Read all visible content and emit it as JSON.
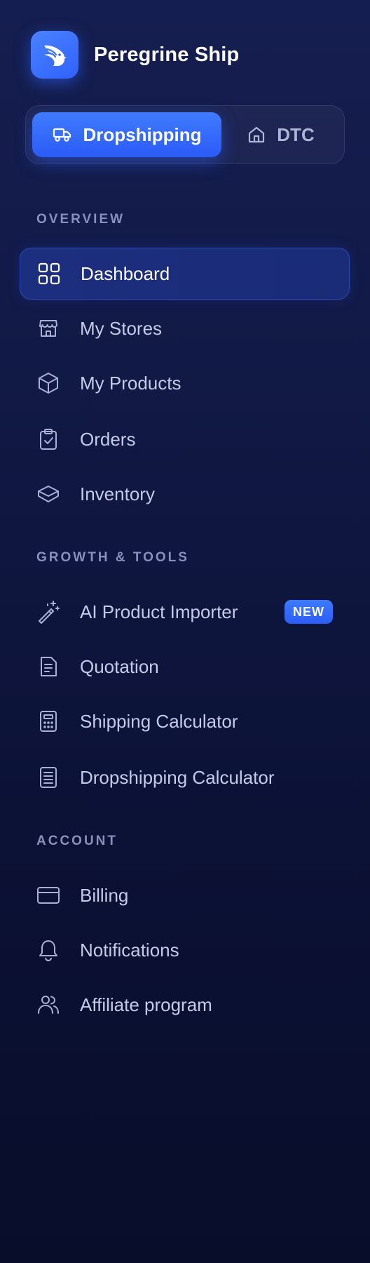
{
  "brand": {
    "name": "Peregrine Ship",
    "logo_icon": "falcon-logo-icon",
    "accent": "#2f62ff"
  },
  "mode_switch": {
    "options": [
      {
        "label": "Dropshipping",
        "icon": "truck-icon",
        "active": true
      },
      {
        "label": "DTC",
        "icon": "home-icon",
        "active": false
      }
    ]
  },
  "sections": {
    "overview": {
      "title": "OVERVIEW",
      "items": [
        {
          "label": "Dashboard",
          "icon": "grid-icon",
          "active": true
        },
        {
          "label": "My Stores",
          "icon": "store-icon"
        },
        {
          "label": "My Products",
          "icon": "box-icon"
        },
        {
          "label": "Orders",
          "icon": "clipboard-check-icon"
        },
        {
          "label": "Inventory",
          "icon": "package-open-icon"
        }
      ]
    },
    "growth": {
      "title": "GROWTH & TOOLS",
      "items": [
        {
          "label": "AI Product Importer",
          "icon": "magic-wand-icon",
          "badge": "NEW"
        },
        {
          "label": "Quotation",
          "icon": "document-icon"
        },
        {
          "label": "Shipping Calculator",
          "icon": "calculator-icon"
        },
        {
          "label": "Dropshipping Calculator",
          "icon": "list-document-icon"
        }
      ]
    },
    "account": {
      "title": "ACCOUNT",
      "items": [
        {
          "label": "Billing",
          "icon": "credit-card-icon"
        },
        {
          "label": "Notifications",
          "icon": "bell-icon"
        },
        {
          "label": "Affiliate program",
          "icon": "users-icon"
        }
      ]
    }
  }
}
